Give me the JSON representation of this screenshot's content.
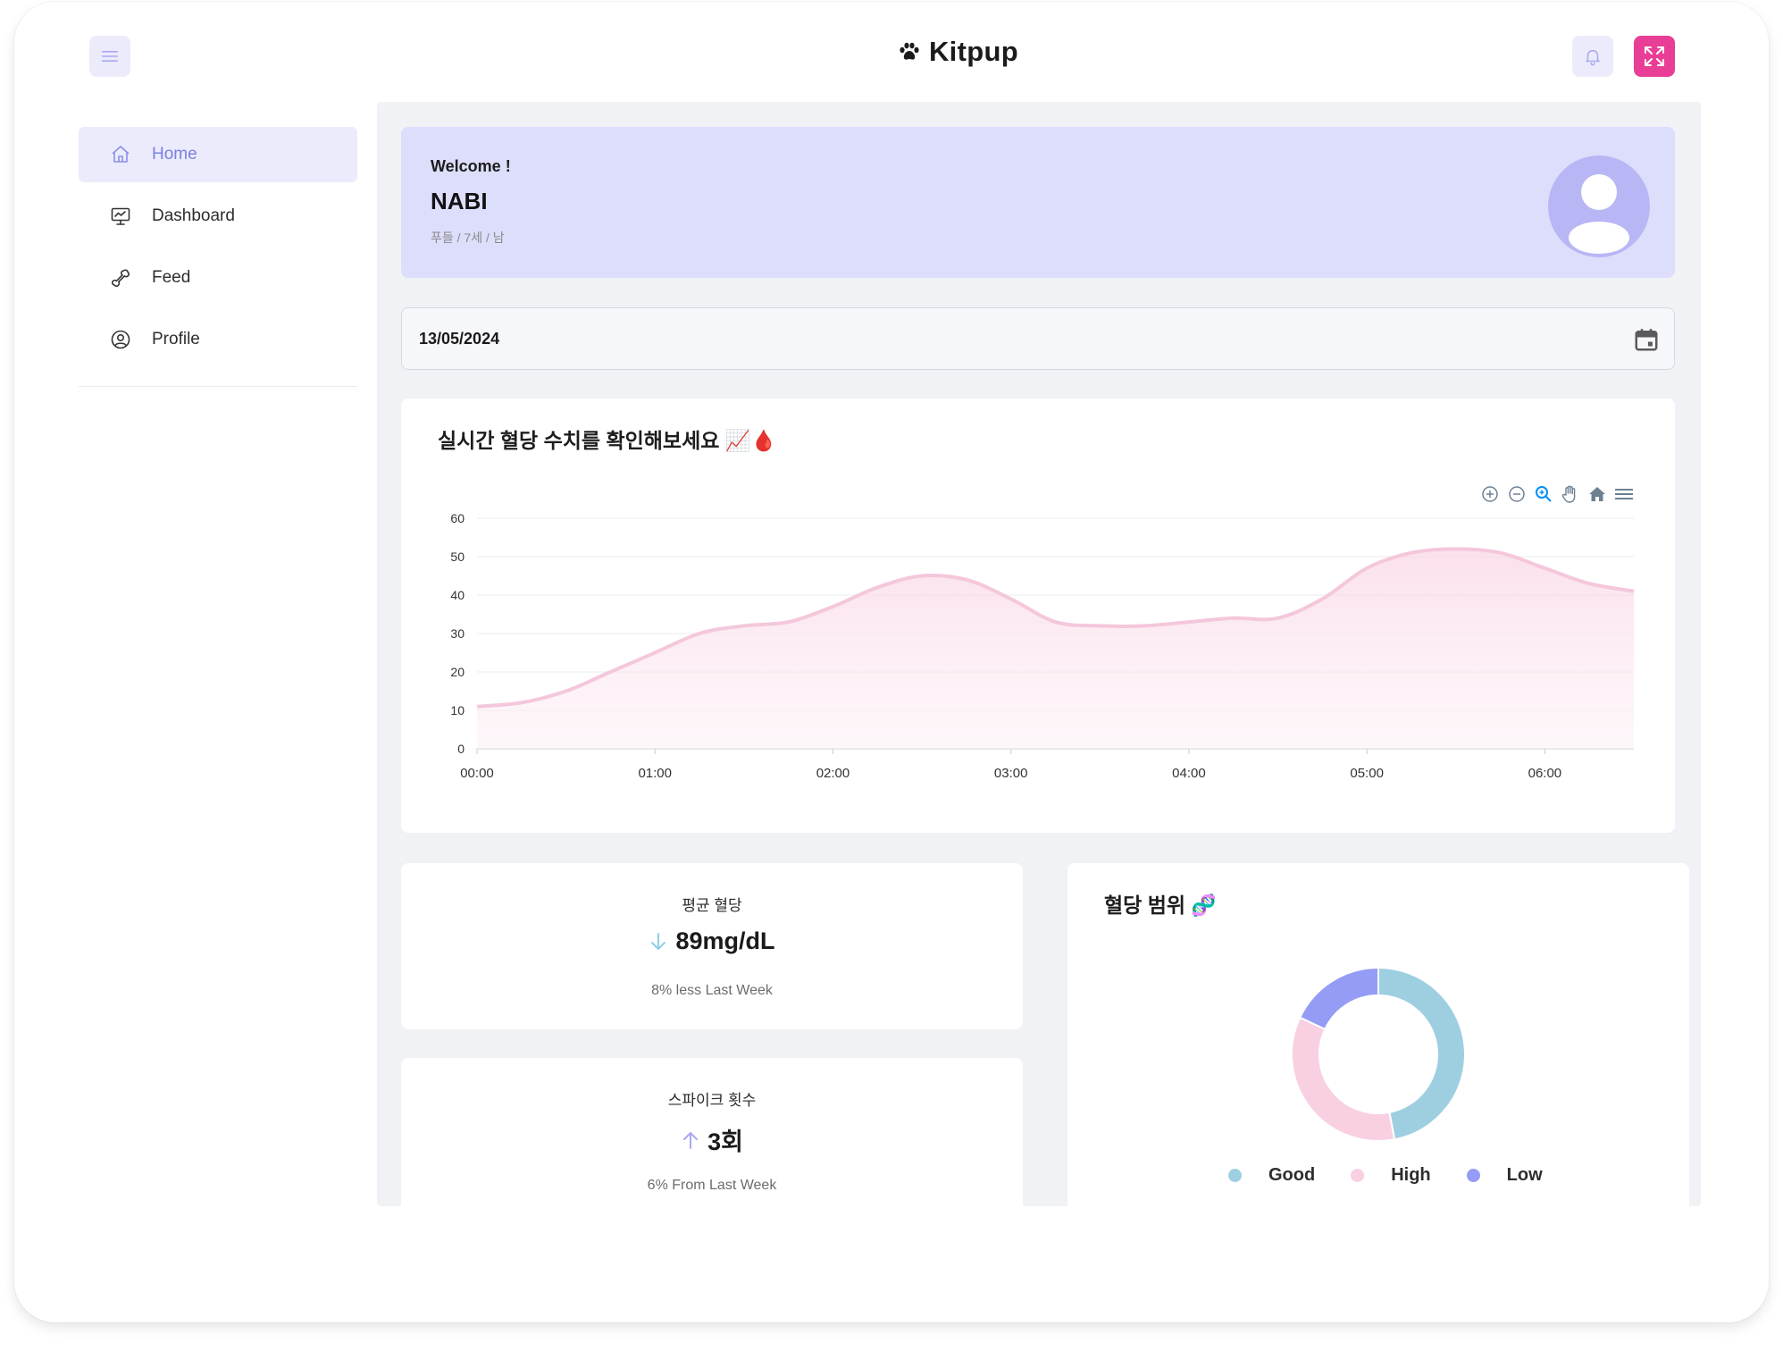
{
  "app": {
    "brand": "Kitpup"
  },
  "header": {
    "menu_icon": "hamburger-icon",
    "logo_icon": "paw-icon",
    "bell_icon": "bell-icon",
    "expand_icon": "fullscreen-icon"
  },
  "sidebar": {
    "items": [
      {
        "label": "Home",
        "icon": "home-icon",
        "active": true
      },
      {
        "label": "Dashboard",
        "icon": "monitor-icon",
        "active": false
      },
      {
        "label": "Feed",
        "icon": "bone-icon",
        "active": false
      },
      {
        "label": "Profile",
        "icon": "user-circle-icon",
        "active": false
      }
    ]
  },
  "welcome": {
    "greeting": "Welcome !",
    "name": "NABI",
    "info": "푸들 / 7세 / 남"
  },
  "date_field": {
    "value": "13/05/2024"
  },
  "realtime_chart": {
    "title": "실시간 혈당 수치를 확인해보세요 📈🩸",
    "toolbar": [
      "zoom-in-icon",
      "zoom-out-icon",
      "selection-zoom-icon",
      "pan-icon",
      "reset-home-icon",
      "menu-icon"
    ]
  },
  "chart_data": [
    {
      "type": "area",
      "x": [
        "00:00",
        "00:15",
        "00:30",
        "00:45",
        "01:00",
        "01:15",
        "01:30",
        "01:45",
        "02:00",
        "02:15",
        "02:30",
        "02:45",
        "03:00",
        "03:15",
        "03:30",
        "03:45",
        "04:00",
        "04:15",
        "04:30",
        "04:45",
        "05:00",
        "05:15",
        "05:30",
        "05:45",
        "06:00",
        "06:15",
        "06:30"
      ],
      "x_ticks": [
        "00:00",
        "01:00",
        "02:00",
        "03:00",
        "04:00",
        "05:00",
        "06:00"
      ],
      "series": [
        {
          "values": [
            11,
            12,
            15,
            20,
            25,
            30,
            32,
            33,
            37,
            42,
            45,
            44,
            39,
            33,
            32,
            32,
            33,
            34,
            34,
            39,
            47,
            51,
            52,
            51,
            47,
            43,
            41
          ]
        }
      ],
      "ylim": [
        0,
        60
      ],
      "y_ticks": [
        0,
        10,
        20,
        30,
        40,
        50,
        60
      ],
      "color": "#f4c7dc",
      "grid": true
    },
    {
      "type": "pie",
      "title": "혈당 범위 🧬",
      "categories": [
        "Good",
        "High",
        "Low"
      ],
      "values": [
        47,
        35,
        18
      ],
      "colors": [
        "#9ecfe1",
        "#f8d0e2",
        "#959cf5"
      ],
      "legend": "bottom"
    }
  ],
  "stats": [
    {
      "title": "평균 혈당",
      "value": "89mg/dL",
      "arrow": "arrow-down-icon",
      "arrow_color": "#8ecfe0",
      "sub": "8% less Last Week"
    },
    {
      "title": "스파이크 횟수",
      "value": "3회",
      "arrow": "arrow-up-icon",
      "arrow_color": "#a9a7f3",
      "sub": "6% From Last Week"
    }
  ],
  "range_card": {
    "title": "혈당 범위 🧬",
    "legend": [
      {
        "label": "Good",
        "color": "#9ecfe1"
      },
      {
        "label": "High",
        "color": "#f8d0e2"
      },
      {
        "label": "Low",
        "color": "#959cf5"
      }
    ]
  },
  "colors": {
    "accent": "#7b7fdc",
    "accent_bg": "#ebebfc",
    "brand_pink": "#e83e96",
    "welcome_bg": "#dddefc",
    "main_bg": "#f1f2f6"
  }
}
